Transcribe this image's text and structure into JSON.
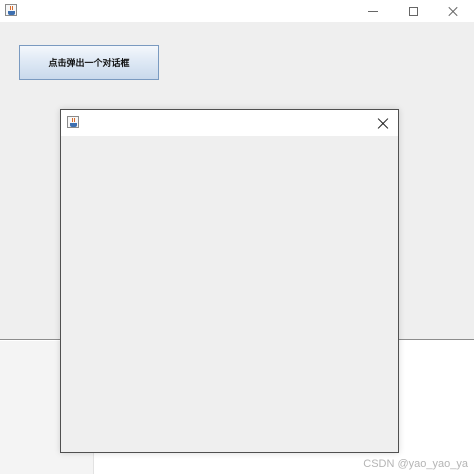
{
  "main_window": {
    "title": "",
    "button_label": "点击弹出一个对话框",
    "app_icon": "java-icon",
    "controls": [
      "minimize-icon",
      "maximize-icon",
      "close-icon"
    ]
  },
  "dialog": {
    "title": "",
    "app_icon": "java-icon",
    "close_icon": "close-icon"
  },
  "watermark": "CSDN @yao_yao_ya"
}
